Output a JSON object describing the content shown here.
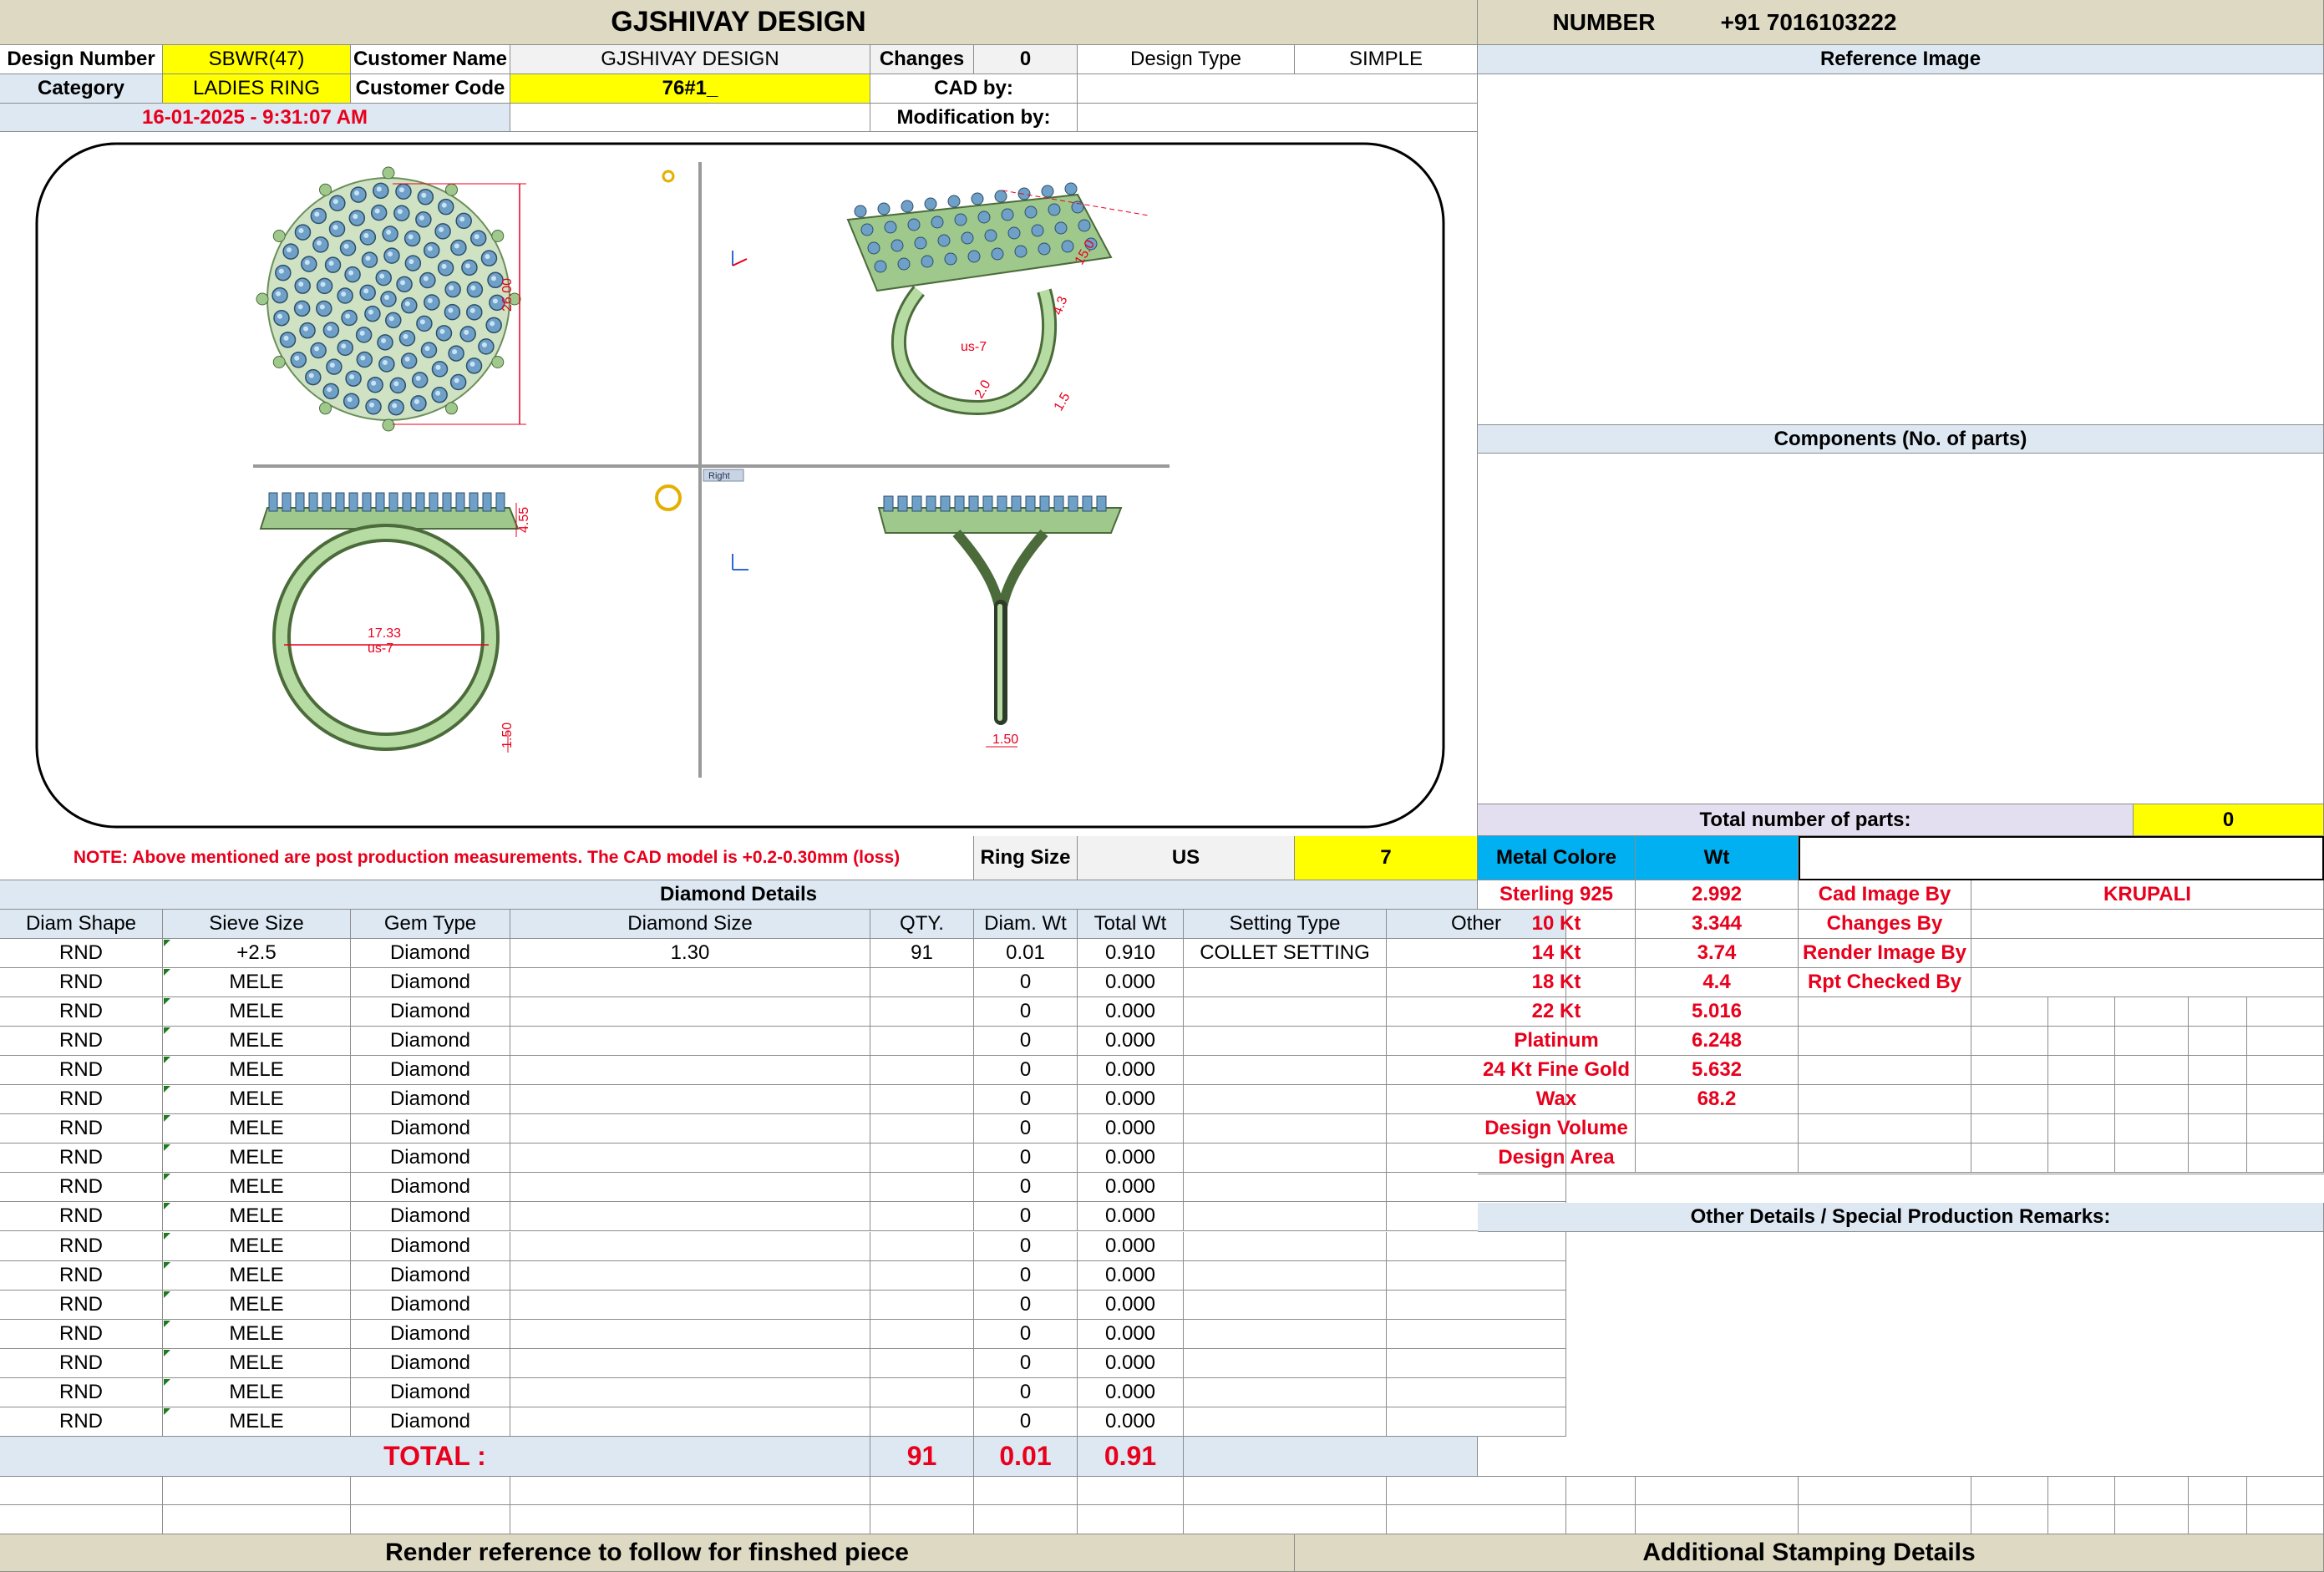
{
  "company": "GJSHIVAY DESIGN",
  "number_label": "NUMBER",
  "number_value": "+91 7016103222",
  "info": {
    "design_number_label": "Design Number",
    "design_number": "SBWR(47)",
    "customer_name_label": "Customer Name",
    "customer_name": "GJSHIVAY DESIGN",
    "changes_label": "Changes",
    "changes": "0",
    "design_type_label": "Design Type",
    "design_type": "SIMPLE",
    "category_label": "Category",
    "category": "LADIES RING",
    "customer_code_label": "Customer Code",
    "customer_code": "76#1_",
    "cad_by_label": "CAD by:",
    "cad_by": "",
    "datetime": "16-01-2025 - 9:31:07 AM",
    "modification_label": "Modification by:",
    "modification": ""
  },
  "views": {
    "top_dim": "26.00",
    "iso_dims": [
      "15.0",
      "2.0",
      "us-7",
      "1.5",
      "4.3"
    ],
    "front_dims": [
      "4.55",
      "17.33",
      "us-7",
      "1.50"
    ],
    "side_dims": [
      "1.50"
    ],
    "viewport_label": "Right"
  },
  "note": "NOTE: Above mentioned are post production measurements. The CAD model is +0.2-0.30mm (loss)",
  "ring": {
    "label": "Ring Size",
    "unit": "US",
    "value": "7"
  },
  "right": {
    "reference_image": "Reference Image",
    "components": "Components (No. of parts)",
    "total_parts_label": "Total number of parts:",
    "total_parts": "0",
    "metal_colore": "Metal Colore",
    "wt": "Wt",
    "metals": [
      {
        "name": "Sterling 925",
        "wt": "2.992"
      },
      {
        "name": "10 Kt",
        "wt": "3.344"
      },
      {
        "name": "14 Kt",
        "wt": "3.74"
      },
      {
        "name": "18 Kt",
        "wt": "4.4"
      },
      {
        "name": "22 Kt",
        "wt": "5.016"
      },
      {
        "name": "Platinum",
        "wt": "6.248"
      },
      {
        "name": "24 Kt Fine Gold",
        "wt": "5.632"
      },
      {
        "name": "Wax",
        "wt": "68.2"
      },
      {
        "name": "Design Volume",
        "wt": ""
      },
      {
        "name": "Design Area",
        "wt": ""
      }
    ],
    "people": [
      {
        "label": "Cad Image By",
        "value": "KRUPALI"
      },
      {
        "label": "Changes By",
        "value": ""
      },
      {
        "label": "Render Image By",
        "value": ""
      },
      {
        "label": "Rpt Checked By",
        "value": ""
      }
    ],
    "other_details": "Other Details / Special Production Remarks:"
  },
  "diamond": {
    "title": "Diamond Details",
    "headers": [
      "Diam Shape",
      "Sieve Size",
      "Gem Type",
      "Diamond Size",
      "QTY.",
      "Diam. Wt",
      "Total Wt",
      "Setting Type",
      "Other"
    ],
    "rows": [
      [
        "RND",
        "+2.5",
        "Diamond",
        "1.30",
        "91",
        "0.01",
        "0.910",
        "COLLET SETTING",
        ""
      ],
      [
        "RND",
        "MELE",
        "Diamond",
        "",
        "",
        "0",
        "0.000",
        "",
        ""
      ],
      [
        "RND",
        "MELE",
        "Diamond",
        "",
        "",
        "0",
        "0.000",
        "",
        ""
      ],
      [
        "RND",
        "MELE",
        "Diamond",
        "",
        "",
        "0",
        "0.000",
        "",
        ""
      ],
      [
        "RND",
        "MELE",
        "Diamond",
        "",
        "",
        "0",
        "0.000",
        "",
        ""
      ],
      [
        "RND",
        "MELE",
        "Diamond",
        "",
        "",
        "0",
        "0.000",
        "",
        ""
      ],
      [
        "RND",
        "MELE",
        "Diamond",
        "",
        "",
        "0",
        "0.000",
        "",
        ""
      ],
      [
        "RND",
        "MELE",
        "Diamond",
        "",
        "",
        "0",
        "0.000",
        "",
        ""
      ],
      [
        "RND",
        "MELE",
        "Diamond",
        "",
        "",
        "0",
        "0.000",
        "",
        ""
      ],
      [
        "RND",
        "MELE",
        "Diamond",
        "",
        "",
        "0",
        "0.000",
        "",
        ""
      ],
      [
        "RND",
        "MELE",
        "Diamond",
        "",
        "",
        "0",
        "0.000",
        "",
        ""
      ],
      [
        "RND",
        "MELE",
        "Diamond",
        "",
        "",
        "0",
        "0.000",
        "",
        ""
      ],
      [
        "RND",
        "MELE",
        "Diamond",
        "",
        "",
        "0",
        "0.000",
        "",
        ""
      ],
      [
        "RND",
        "MELE",
        "Diamond",
        "",
        "",
        "0",
        "0.000",
        "",
        ""
      ],
      [
        "RND",
        "MELE",
        "Diamond",
        "",
        "",
        "0",
        "0.000",
        "",
        ""
      ],
      [
        "RND",
        "MELE",
        "Diamond",
        "",
        "",
        "0",
        "0.000",
        "",
        ""
      ],
      [
        "RND",
        "MELE",
        "Diamond",
        "",
        "",
        "0",
        "0.000",
        "",
        ""
      ]
    ],
    "total_label": "TOTAL :",
    "total_qty": "91",
    "total_diam_wt": "0.01",
    "total_wt": "0.91"
  },
  "footer": {
    "render_reference": "Render reference to follow for finshed piece",
    "stamping": "Additional Stamping Details"
  }
}
